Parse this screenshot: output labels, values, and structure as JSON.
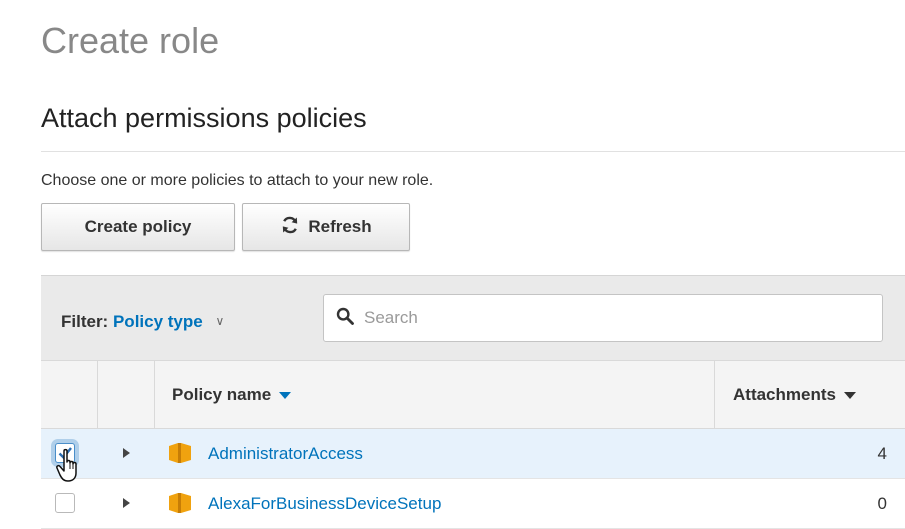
{
  "page_title": "Create role",
  "section_title": "Attach permissions policies",
  "description": "Choose one or more policies to attach to your new role.",
  "buttons": {
    "create_policy": "Create policy",
    "refresh": "Refresh"
  },
  "filter": {
    "label": "Filter:",
    "value": "Policy type"
  },
  "search": {
    "placeholder": "Search",
    "value": ""
  },
  "table": {
    "columns": {
      "policy_name": "Policy name",
      "attachments": "Attachments"
    },
    "rows": [
      {
        "name": "AdministratorAccess",
        "attachments": "4",
        "checked": true
      },
      {
        "name": "AlexaForBusinessDeviceSetup",
        "attachments": "0",
        "checked": false
      }
    ]
  },
  "icons": {
    "refresh": "refresh-icon",
    "search": "search-icon",
    "policy": "policy-box-icon",
    "cursor": "hand-pointer-icon"
  },
  "colors": {
    "link": "#0073bb",
    "selected_row": "#e7f2fc",
    "policy_icon": "#f0a20f"
  }
}
